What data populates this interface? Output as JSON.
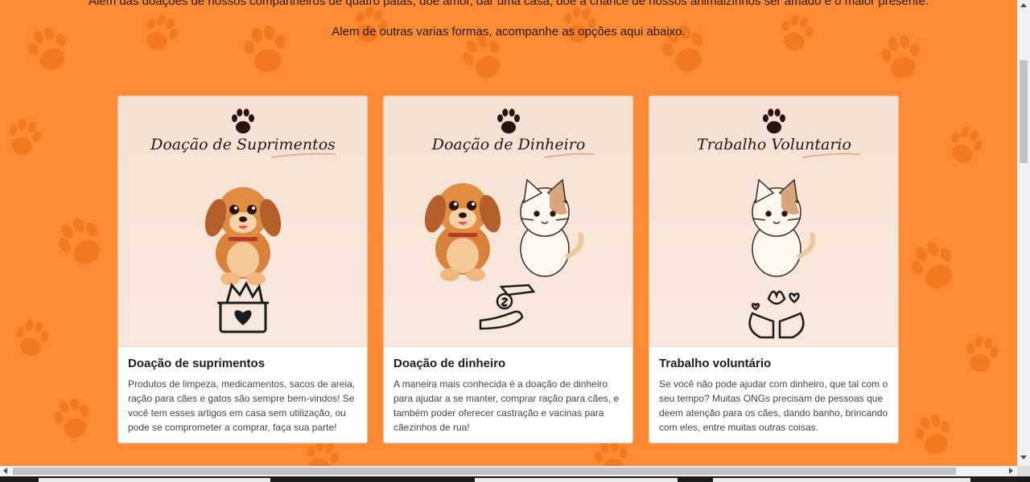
{
  "intro": {
    "line1": "Alem das doações de nossos companheiros de quatro patas, doe amor, dar uma casa, doe a chance de nossos animalzinhos ser amado e o maior presente.",
    "line2": "Alem de outras varias formas, acompanhe as opções aqui abaixo."
  },
  "colors": {
    "background": "#fd8a35",
    "paw_pattern": "#f27920",
    "card_image_bg": "#f6e1d3",
    "card_bg": "#ffffff",
    "heading_dark": "#2b1410"
  },
  "cards": [
    {
      "image_heading": "Doação de Suprimentos",
      "image_icons": [
        "paw-icon",
        "puppy-illustration",
        "donation-box-icon"
      ],
      "title": "Doação de suprimentos",
      "text": "Produtos de limpeza, medicamentos, sacos de areia, ração para cães e gatos são sempre bem-vindos! Se você tem esses artigos em casa sem utilização, ou pode se comprometer a comprar, faça sua parte!"
    },
    {
      "image_heading": "Doação de Dinheiro",
      "image_icons": [
        "paw-icon",
        "puppy-illustration",
        "kitten-illustration",
        "coin-hands-icon"
      ],
      "title": "Doação de dinheiro",
      "text": "A maneira mais conhecida é a doação de dinheiro para ajudar a se manter, comprar ração para cães, e também poder oferecer castração e vacinas para cãezinhos de rua!"
    },
    {
      "image_heading": "Trabalho Voluntario",
      "image_icons": [
        "paw-icon",
        "kitten-illustration",
        "volunteer-hands-icon"
      ],
      "title": "Trabalho voluntário",
      "text": "Se você não pode ajudar com dinheiro, que tal com o seu tempo? Muitas ONGs precisam de pessoas que deem atenção para os cães, dando banho, brincando com eles, entre muitas outras coisas."
    }
  ]
}
